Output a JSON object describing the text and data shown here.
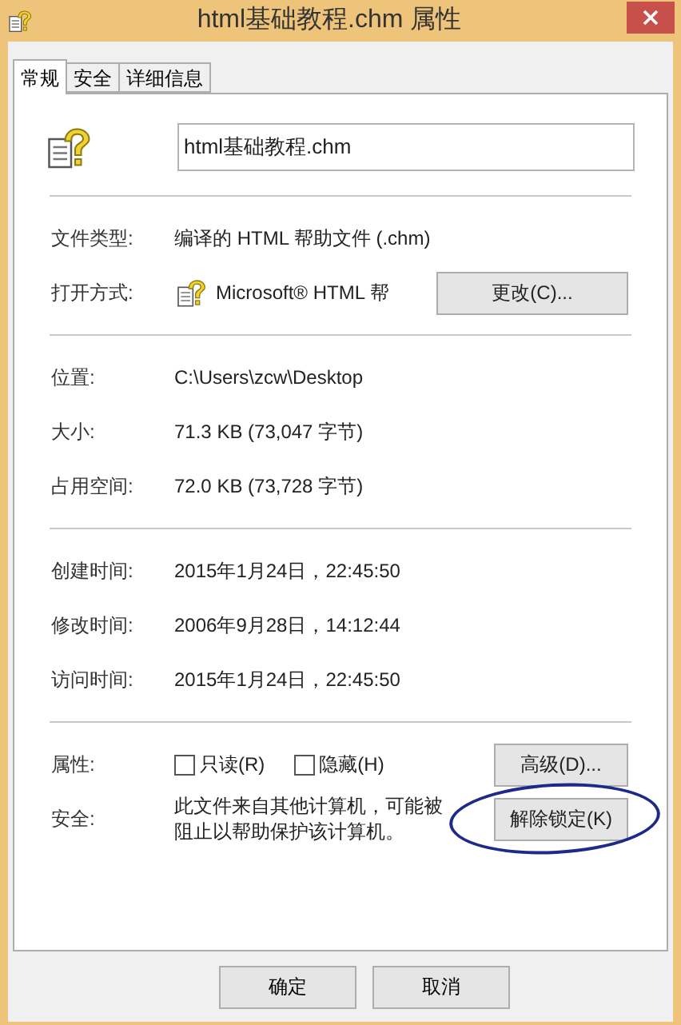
{
  "window": {
    "title": "html基础教程.chm 属性"
  },
  "tabs": [
    {
      "label": "常规",
      "selected": true
    },
    {
      "label": "安全",
      "selected": false
    },
    {
      "label": "详细信息",
      "selected": false
    }
  ],
  "name_field": {
    "value": "html基础教程.chm"
  },
  "sections": [
    {
      "rows": [
        {
          "kind": "text",
          "label": "文件类型:",
          "value": "编译的 HTML 帮助文件 (.chm)"
        },
        {
          "kind": "app",
          "label": "打开方式:",
          "value": "Microsoft® HTML 帮",
          "button": "更改(C)..."
        }
      ]
    },
    {
      "rows": [
        {
          "kind": "text",
          "label": "位置:",
          "value": "C:\\Users\\zcw\\Desktop"
        },
        {
          "kind": "text",
          "label": "大小:",
          "value": "71.3 KB (73,047 字节)"
        },
        {
          "kind": "text",
          "label": "占用空间:",
          "value": "72.0 KB (73,728 字节)"
        }
      ]
    },
    {
      "rows": [
        {
          "kind": "text",
          "label": "创建时间:",
          "value": "2015年1月24日，22:45:50"
        },
        {
          "kind": "text",
          "label": "修改时间:",
          "value": "2006年9月28日，14:12:44"
        },
        {
          "kind": "text",
          "label": "访问时间:",
          "value": "2015年1月24日，22:45:50"
        }
      ]
    },
    {
      "rows": [
        {
          "kind": "attributes",
          "label": "属性:",
          "checkboxes": [
            {
              "label": "只读(R)",
              "checked": false
            },
            {
              "label": "隐藏(H)",
              "checked": false
            }
          ],
          "button": "高级(D)..."
        },
        {
          "kind": "security",
          "label": "安全:",
          "value": "此文件来自其他计算机，可能被阻止以帮助保护该计算机。",
          "button": "解除锁定(K)",
          "circled": true
        }
      ]
    }
  ],
  "buttons": [
    {
      "label": "确定"
    },
    {
      "label": "取消"
    }
  ]
}
